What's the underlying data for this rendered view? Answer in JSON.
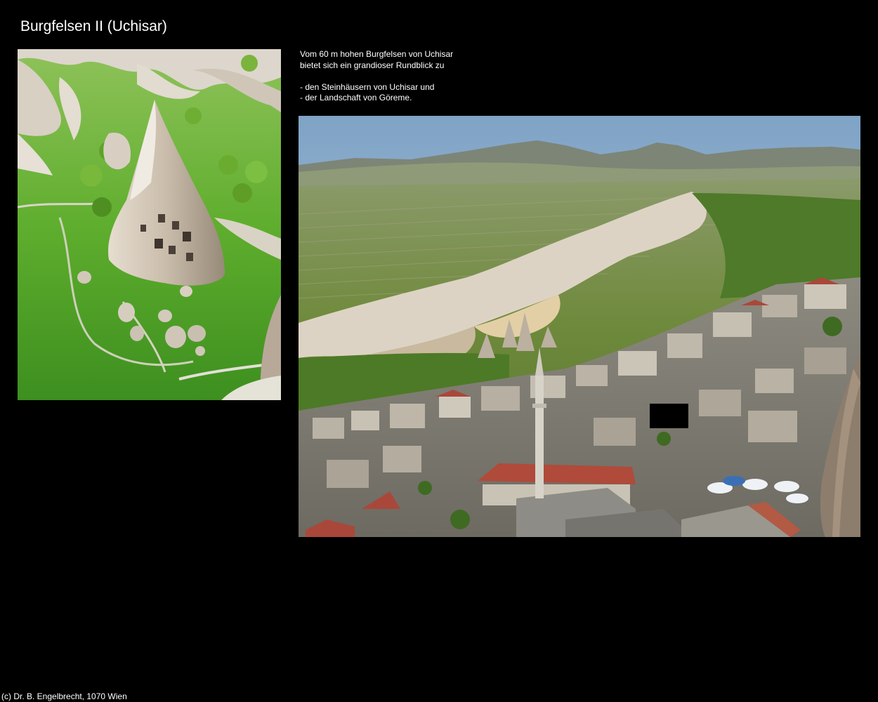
{
  "page": {
    "title": "Burgfelsen II (Uchisar)",
    "footer": "(c) Dr. B. Engelbrecht, 1070 Wien",
    "background_color": "#000000",
    "text_color": "#ffffff"
  },
  "description": {
    "intro_lines": [
      "Vom 60 m hohen Burgfelsen von Uchisar",
      "bietet sich ein grandioser Rundblick zu"
    ],
    "bullet_lines": [
      "- den Steinhäusern von Uchisar und",
      "- der Landschaft von Göreme."
    ]
  }
}
